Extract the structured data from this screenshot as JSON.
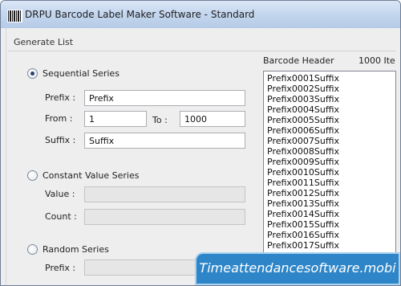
{
  "window": {
    "title": "DRPU Barcode Label Maker Software - Standard"
  },
  "group": {
    "title": "Generate List"
  },
  "sequential": {
    "label": "Sequential Series",
    "selected": true,
    "prefix_label": "Prefix :",
    "prefix_value": "Prefix",
    "from_label": "From :",
    "from_value": "1",
    "to_label": "To :",
    "to_value": "1000",
    "suffix_label": "Suffix :",
    "suffix_value": "Suffix"
  },
  "constant": {
    "label": "Constant Value Series",
    "selected": false,
    "value_label": "Value :",
    "value_value": "",
    "count_label": "Count :",
    "count_value": ""
  },
  "random": {
    "label": "Random Series",
    "selected": false,
    "prefix_label": "Prefix :",
    "prefix_value": ""
  },
  "list": {
    "header_label": "Barcode Header",
    "header_count": "1000 Ite",
    "items": [
      "Prefix0001Suffix",
      "Prefix0002Suffix",
      "Prefix0003Suffix",
      "Prefix0004Suffix",
      "Prefix0005Suffix",
      "Prefix0006Suffix",
      "Prefix0007Suffix",
      "Prefix0008Suffix",
      "Prefix0009Suffix",
      "Prefix0010Suffix",
      "Prefix0011Suffix",
      "Prefix0012Suffix",
      "Prefix0013Suffix",
      "Prefix0014Suffix",
      "Prefix0015Suffix",
      "Prefix0016Suffix",
      "Prefix0017Suffix"
    ]
  },
  "watermark": {
    "text": "Timeattendancesoftware.mobi"
  }
}
